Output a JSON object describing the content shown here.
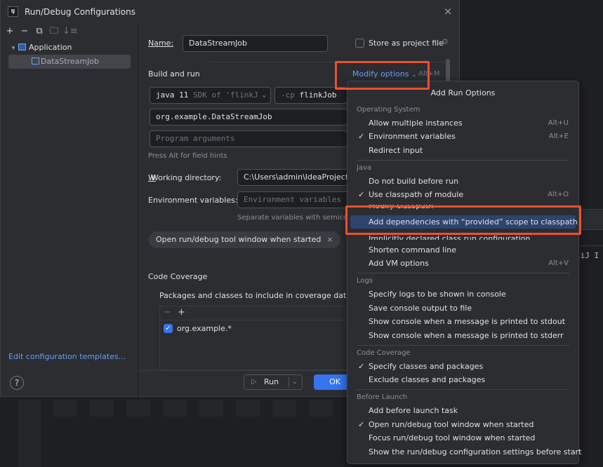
{
  "window": {
    "app_icon": "IJ",
    "title": "Run/Debug Configurations",
    "close": "×"
  },
  "toolbar": {
    "add": "+",
    "remove": "−",
    "copy": "⧉",
    "folder": "🗀",
    "sort": "↓≡"
  },
  "tree": {
    "group": "Application",
    "item": "DataStreamJob",
    "collapse_glyph": "▾"
  },
  "left_footer": {
    "edit_templates": "Edit configuration templates...",
    "help": "?"
  },
  "form": {
    "name_label": "Name:",
    "name_value": "DataStreamJob",
    "store_label": "Store as project file",
    "build_run_heading": "Build and run",
    "modify_options": "Modify options",
    "modify_shortcut": "Alt+M",
    "sdk_prefix": "java 11",
    "sdk_hint": "SDK of 'flinkJ",
    "cp_prefix": "-cp",
    "cp_module": "flinkJob",
    "main_class": "org.example.DataStreamJob",
    "program_args_placeholder": "Program arguments",
    "field_hint": "Press Alt for field hints",
    "workdir_label": "Working directory:",
    "workdir_value": "C:\\Users\\admin\\IdeaProjects\\fl",
    "env_label": "Environment variables:",
    "env_placeholder": "Environment variables",
    "env_hint": "Separate variables with semicolon",
    "chip_label": "Open run/debug tool window when started",
    "chip_close": "×",
    "coverage_heading": "Code Coverage",
    "coverage_sub": "Packages and classes to include in coverage data",
    "coverage_pattern": "org.example.*",
    "run_label": "Run",
    "ok_label": "OK"
  },
  "background": {
    "code_snippet": "liJ I"
  },
  "popup": {
    "title": "Add Run Options",
    "sections": [
      {
        "name": "Operating System",
        "items": [
          {
            "label": "Allow multiple instances",
            "shortcut": "Alt+U",
            "checked": false
          },
          {
            "label": "Environment variables",
            "shortcut": "Alt+E",
            "checked": true
          },
          {
            "label": "Redirect input",
            "shortcut": "",
            "checked": false
          }
        ]
      },
      {
        "name": "Java",
        "items": [
          {
            "label": "Do not build before run",
            "shortcut": "",
            "checked": false
          },
          {
            "label": "Use classpath of module",
            "shortcut": "Alt+O",
            "checked": true
          },
          {
            "label": "Modify classpath",
            "shortcut": "",
            "checked": false
          },
          {
            "label": "Add dependencies with “provided” scope to classpath",
            "shortcut": "",
            "checked": false
          },
          {
            "label": "Implicitly declared class run configuration",
            "shortcut": "",
            "checked": false
          },
          {
            "label": "Shorten command line",
            "shortcut": "",
            "checked": false
          },
          {
            "label": "Add VM options",
            "shortcut": "Alt+V",
            "checked": false
          }
        ]
      },
      {
        "name": "Logs",
        "items": [
          {
            "label": "Specify logs to be shown in console",
            "shortcut": "",
            "checked": false
          },
          {
            "label": "Save console output to file",
            "shortcut": "",
            "checked": false
          },
          {
            "label": "Show console when a message is printed to stdout",
            "shortcut": "",
            "checked": false
          },
          {
            "label": "Show console when a message is printed to stderr",
            "shortcut": "",
            "checked": false
          }
        ]
      },
      {
        "name": "Code Coverage",
        "items": [
          {
            "label": "Specify classes and packages",
            "shortcut": "",
            "checked": true
          },
          {
            "label": "Exclude classes and packages",
            "shortcut": "",
            "checked": false
          }
        ]
      },
      {
        "name": "Before Launch",
        "items": [
          {
            "label": "Add before launch task",
            "shortcut": "",
            "checked": false
          },
          {
            "label": "Open run/debug tool window when started",
            "shortcut": "",
            "checked": true
          },
          {
            "label": "Focus run/debug tool window when started",
            "shortcut": "",
            "checked": false
          },
          {
            "label": "Show the run/debug configuration settings before start",
            "shortcut": "",
            "checked": false
          }
        ]
      }
    ]
  },
  "colors": {
    "accent": "#3574f0",
    "link": "#6c9ef8",
    "highlight_box": "#f04e2f",
    "selection": "#2e436e"
  }
}
